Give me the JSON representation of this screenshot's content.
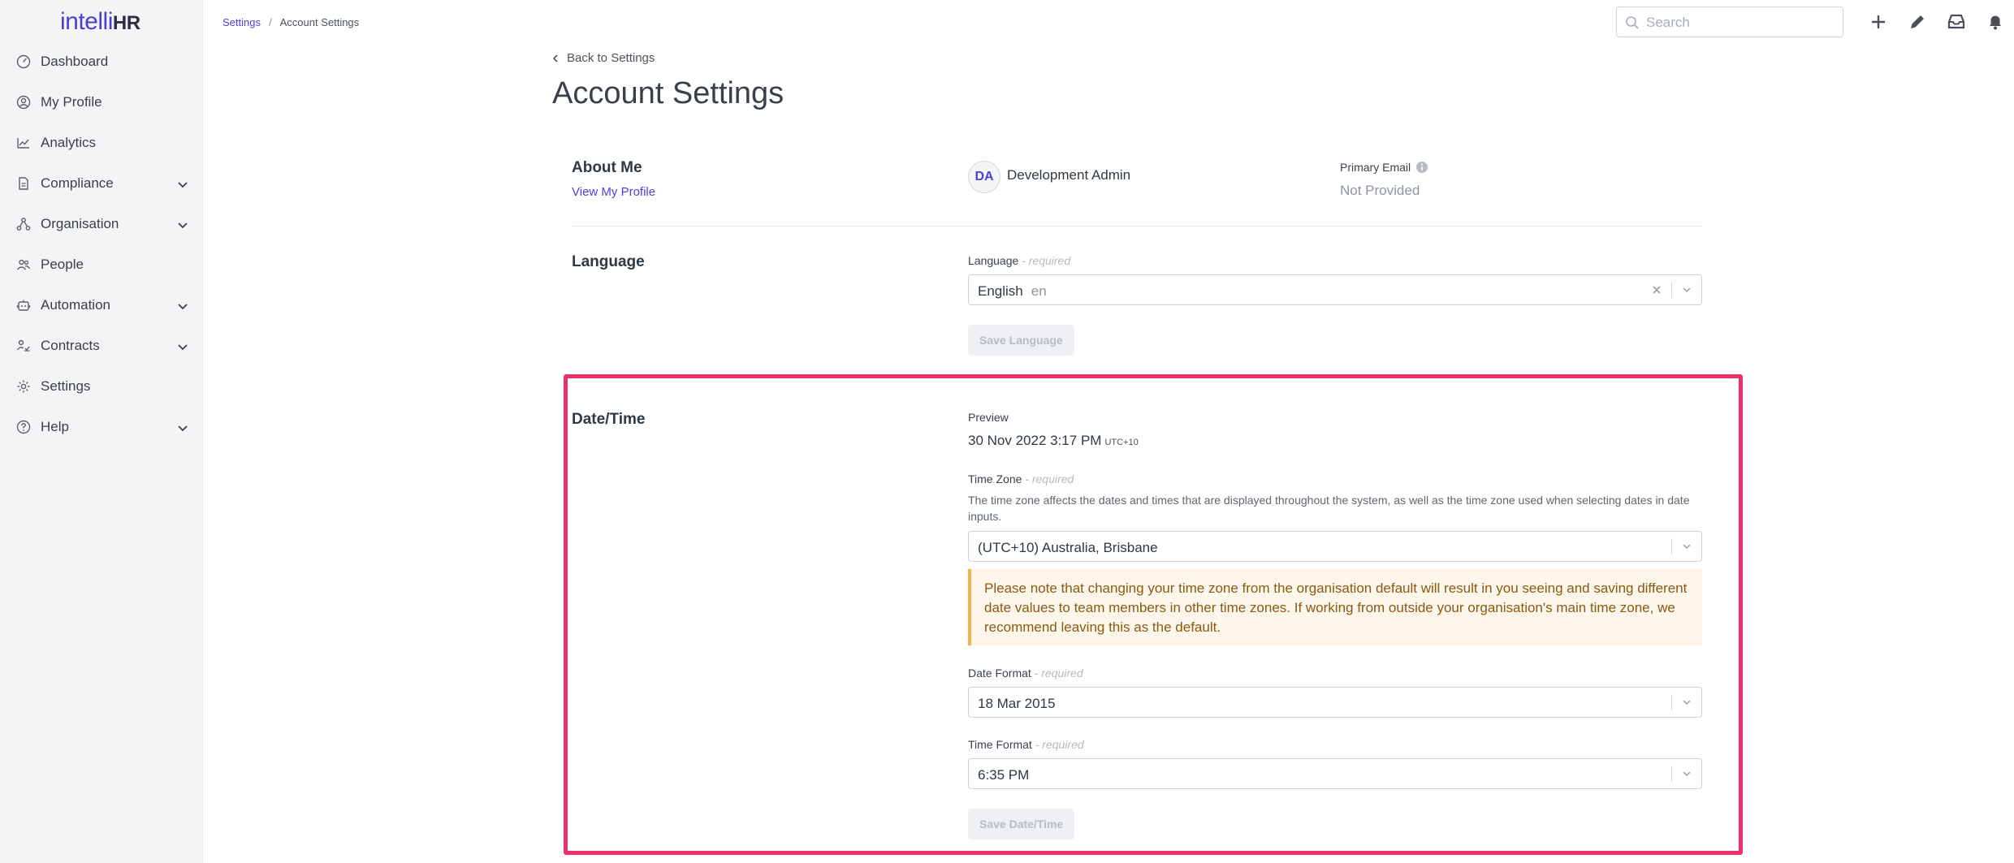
{
  "brand": {
    "logo_part1": "intelli",
    "logo_part2": "HR"
  },
  "sidebar": {
    "items": [
      {
        "label": "Dashboard"
      },
      {
        "label": "My Profile"
      },
      {
        "label": "Analytics"
      },
      {
        "label": "Compliance"
      },
      {
        "label": "Organisation"
      },
      {
        "label": "People"
      },
      {
        "label": "Automation"
      },
      {
        "label": "Contracts"
      },
      {
        "label": "Settings"
      },
      {
        "label": "Help"
      }
    ]
  },
  "breadcrumb": {
    "parent": "Settings",
    "separator": "/",
    "current": "Account Settings"
  },
  "search": {
    "placeholder": "Search"
  },
  "page": {
    "back_label": "Back to Settings",
    "title": "Account Settings"
  },
  "about": {
    "title": "About Me",
    "view_profile": "View My Profile",
    "avatar_initials": "DA",
    "user_name": "Development Admin",
    "primary_email_label": "Primary Email",
    "primary_email_value": "Not Provided"
  },
  "language": {
    "title": "Language",
    "field_label": "Language",
    "required_text": "- required",
    "selected": "English",
    "selected_code": "en",
    "save_label": "Save Language"
  },
  "datetime": {
    "title": "Date/Time",
    "preview_label": "Preview",
    "preview_value": "30 Nov 2022 3:17 PM",
    "preview_tz": "UTC+10",
    "timezone_label": "Time Zone",
    "required_text": "- required",
    "timezone_help": "The time zone affects the dates and times that are displayed throughout the system, as well as the time zone used when selecting dates in date inputs.",
    "timezone_value": "(UTC+10) Australia, Brisbane",
    "notice": "Please note that changing your time zone from the organisation default will result in you seeing and saving different date values to team members in other time zones. If working from outside your organisation's main time zone, we recommend leaving this as the default.",
    "date_format_label": "Date Format",
    "date_format_value": "18 Mar 2015",
    "time_format_label": "Time Format",
    "time_format_value": "6:35 PM",
    "save_label": "Save Date/Time"
  },
  "colors": {
    "accent": "#4b3fd8",
    "highlight": "#ee2f68",
    "notice_border": "#f0b24a",
    "notice_bg": "#fdf6ea"
  }
}
